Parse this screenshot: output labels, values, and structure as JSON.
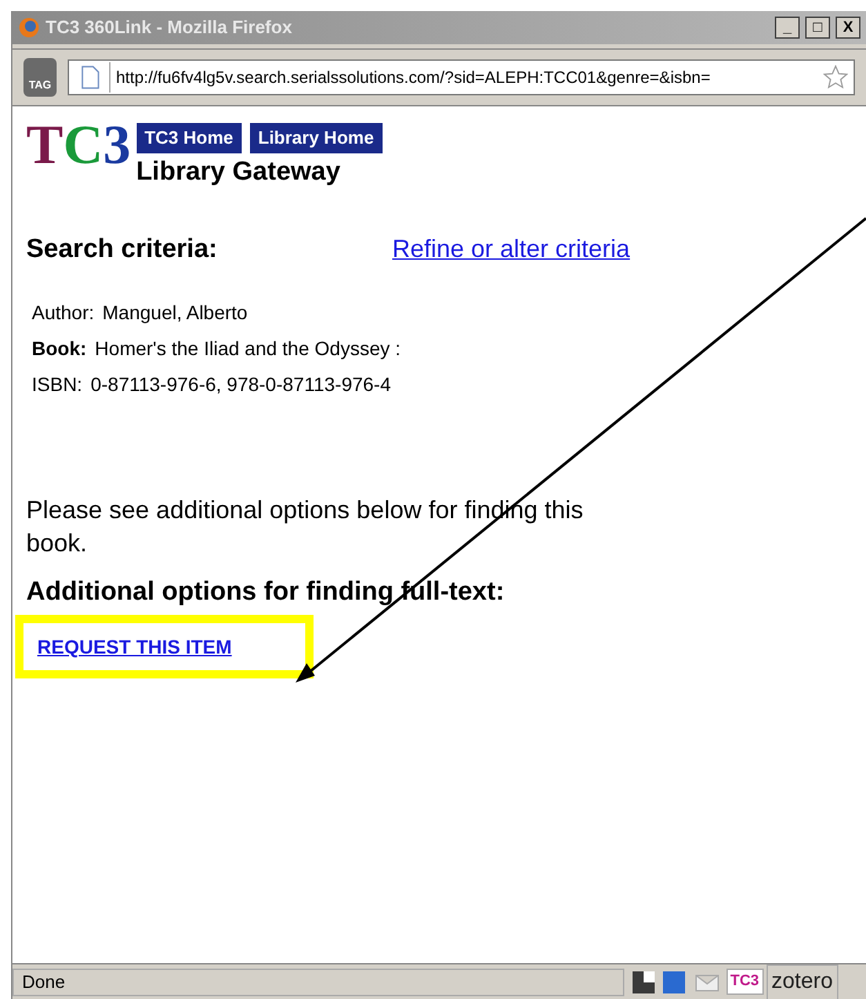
{
  "window": {
    "title": "TC3 360Link - Mozilla Firefox",
    "controls": [
      "_",
      "□",
      "X"
    ]
  },
  "toolbar": {
    "tag_label": "TAG",
    "url": "http://fu6fv4lg5v.search.serialssolutions.com/?sid=ALEPH:TCC01&genre=&isbn="
  },
  "header": {
    "logo_letters": [
      {
        "text": "T",
        "color": "#7a1a4a"
      },
      {
        "text": "C",
        "color": "#1a9a3a"
      },
      {
        "text": "3",
        "color": "#1a3aa0"
      }
    ],
    "nav_links": [
      "TC3 Home",
      "Library Home"
    ],
    "gateway": "Library Gateway"
  },
  "criteria": {
    "heading": "Search criteria:",
    "refine_link": "Refine or alter criteria",
    "fields": [
      {
        "label": "Author:",
        "value": "Manguel, Alberto",
        "bold": false
      },
      {
        "label": "Book:",
        "value": "Homer's the Iliad and the Odyssey :",
        "bold": true
      },
      {
        "label": "ISBN:",
        "value": "0-87113-976-6, 978-0-87113-976-4",
        "bold": false
      }
    ]
  },
  "note": "Please see additional options below for finding this book.",
  "options": {
    "heading": "Additional options for finding full-text:",
    "request_link": "REQUEST THIS ITEM"
  },
  "status_bar": {
    "text": "Done",
    "zotero": "zotero",
    "tc3_badge": "TC3"
  }
}
